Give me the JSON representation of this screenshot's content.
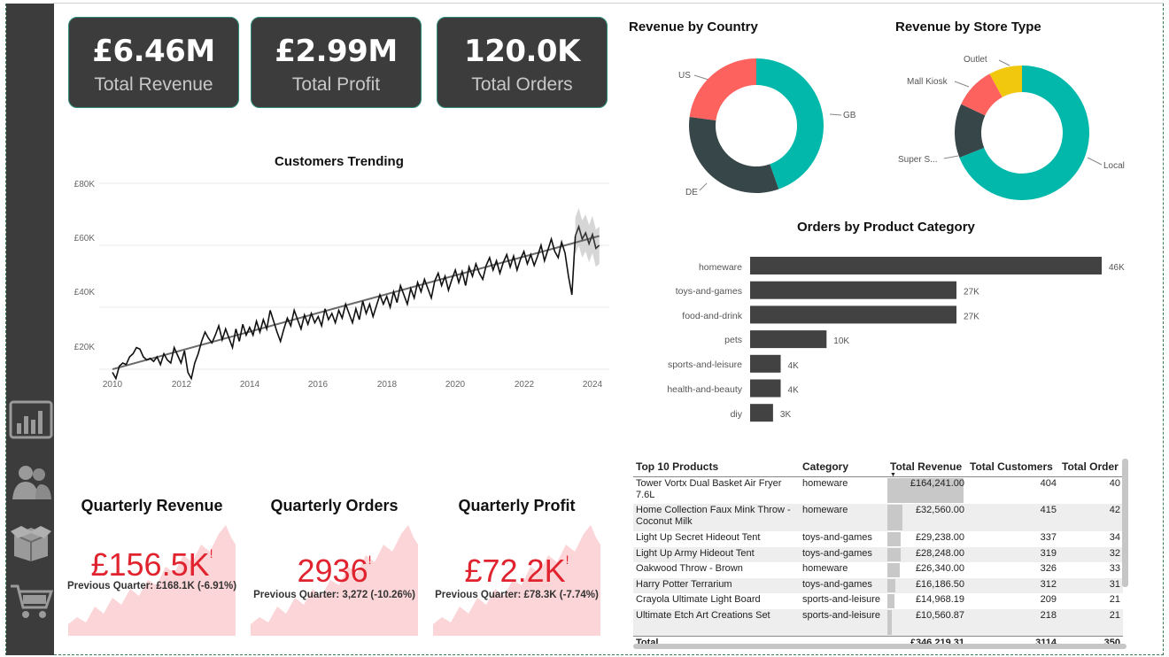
{
  "cards": [
    {
      "value": "£6.46M",
      "label": "Total Revenue"
    },
    {
      "value": "£2.99M",
      "label": "Total Profit"
    },
    {
      "value": "120.0K",
      "label": "Total Orders"
    }
  ],
  "nav": {
    "icons": [
      "bar-chart-icon",
      "users-icon",
      "package-icon",
      "cart-icon"
    ]
  },
  "customers_trending": {
    "title": "Customers Trending",
    "y_ticks": [
      "£80K",
      "£60K",
      "£40K",
      "£20K"
    ],
    "x_ticks": [
      "2010",
      "2012",
      "2014",
      "2016",
      "2018",
      "2020",
      "2022",
      "2024"
    ]
  },
  "revenue_by_country": {
    "title": "Revenue by Country",
    "labels": [
      "GB",
      "DE",
      "US"
    ]
  },
  "revenue_by_store": {
    "title": "Revenue by Store Type",
    "labels": [
      "Local",
      "Super S...",
      "Mall Kiosk",
      "Outlet"
    ]
  },
  "orders_by_category": {
    "title": "Orders by Product Category",
    "value_labels": [
      "46K",
      "27K",
      "27K",
      "10K",
      "4K",
      "4K",
      "3K"
    ]
  },
  "chart_data": [
    {
      "type": "line",
      "title": "Customers Trending",
      "xlabel": "",
      "ylabel": "",
      "xlim": [
        2010,
        2024.5
      ],
      "ylim": [
        10000,
        80000
      ],
      "series": [
        {
          "values": [
            [
              2010.0,
              19000
            ],
            [
              2010.1,
              17000
            ],
            [
              2010.2,
              21000
            ],
            [
              2010.3,
              22000
            ],
            [
              2010.4,
              21500
            ],
            [
              2010.5,
              24000
            ],
            [
              2010.6,
              25000
            ],
            [
              2010.7,
              27000
            ],
            [
              2010.8,
              26500
            ],
            [
              2010.9,
              24000
            ],
            [
              2011.0,
              23000
            ],
            [
              2011.1,
              23500
            ],
            [
              2011.2,
              22500
            ],
            [
              2011.3,
              24000
            ],
            [
              2011.4,
              21500
            ],
            [
              2011.5,
              25000
            ],
            [
              2011.6,
              23000
            ],
            [
              2011.7,
              22000
            ],
            [
              2011.8,
              27000
            ],
            [
              2011.9,
              24500
            ],
            [
              2012.0,
              22000
            ],
            [
              2012.1,
              26000
            ],
            [
              2012.2,
              19000
            ],
            [
              2012.3,
              17000
            ],
            [
              2012.4,
              22000
            ],
            [
              2012.5,
              25000
            ],
            [
              2012.6,
              29000
            ],
            [
              2012.7,
              32000
            ],
            [
              2012.8,
              30000
            ],
            [
              2012.9,
              28500
            ],
            [
              2013.0,
              31000
            ],
            [
              2013.1,
              34000
            ],
            [
              2013.2,
              29500
            ],
            [
              2013.3,
              33000
            ],
            [
              2013.4,
              30000
            ],
            [
              2013.5,
              27000
            ],
            [
              2013.6,
              33000
            ],
            [
              2013.7,
              29000
            ],
            [
              2013.8,
              34500
            ],
            [
              2013.9,
              31000
            ],
            [
              2014.0,
              33500
            ],
            [
              2014.1,
              31000
            ],
            [
              2014.2,
              35500
            ],
            [
              2014.3,
              32000
            ],
            [
              2014.4,
              36000
            ],
            [
              2014.5,
              33000
            ],
            [
              2014.6,
              39000
            ],
            [
              2014.7,
              35500
            ],
            [
              2014.8,
              32000
            ],
            [
              2014.9,
              29000
            ],
            [
              2015.0,
              33000
            ],
            [
              2015.1,
              36500
            ],
            [
              2015.2,
              34000
            ],
            [
              2015.3,
              39000
            ],
            [
              2015.4,
              36000
            ],
            [
              2015.5,
              33000
            ],
            [
              2015.6,
              37500
            ],
            [
              2015.7,
              34500
            ],
            [
              2015.8,
              38000
            ],
            [
              2015.9,
              35000
            ],
            [
              2016.0,
              37000
            ],
            [
              2016.1,
              34000
            ],
            [
              2016.2,
              39500
            ],
            [
              2016.3,
              36000
            ],
            [
              2016.4,
              38000
            ],
            [
              2016.5,
              35000
            ],
            [
              2016.6,
              39000
            ],
            [
              2016.7,
              36500
            ],
            [
              2016.8,
              41000
            ],
            [
              2016.9,
              38000
            ],
            [
              2017.0,
              35000
            ],
            [
              2017.1,
              39500
            ],
            [
              2017.2,
              36000
            ],
            [
              2017.3,
              42000
            ],
            [
              2017.4,
              38000
            ],
            [
              2017.5,
              41000
            ],
            [
              2017.6,
              37000
            ],
            [
              2017.7,
              40500
            ],
            [
              2017.8,
              44000
            ],
            [
              2017.9,
              41000
            ],
            [
              2018.0,
              43500
            ],
            [
              2018.1,
              40000
            ],
            [
              2018.2,
              45000
            ],
            [
              2018.3,
              41500
            ],
            [
              2018.4,
              47000
            ],
            [
              2018.5,
              44000
            ],
            [
              2018.6,
              41000
            ],
            [
              2018.7,
              46000
            ],
            [
              2018.8,
              43000
            ],
            [
              2018.9,
              48000
            ],
            [
              2019.0,
              45000
            ],
            [
              2019.1,
              49000
            ],
            [
              2019.2,
              46000
            ],
            [
              2019.3,
              43000
            ],
            [
              2019.4,
              48500
            ],
            [
              2019.5,
              51000
            ],
            [
              2019.6,
              47000
            ],
            [
              2019.7,
              50000
            ],
            [
              2019.8,
              45500
            ],
            [
              2019.9,
              49000
            ],
            [
              2020.0,
              52000
            ],
            [
              2020.1,
              48000
            ],
            [
              2020.2,
              51500
            ],
            [
              2020.3,
              47000
            ],
            [
              2020.4,
              53000
            ],
            [
              2020.5,
              50000
            ],
            [
              2020.6,
              54000
            ],
            [
              2020.7,
              51000
            ],
            [
              2020.8,
              49000
            ],
            [
              2020.9,
              53500
            ],
            [
              2021.0,
              56000
            ],
            [
              2021.1,
              52000
            ],
            [
              2021.2,
              55000
            ],
            [
              2021.3,
              51000
            ],
            [
              2021.4,
              54500
            ],
            [
              2021.5,
              57000
            ],
            [
              2021.6,
              53000
            ],
            [
              2021.7,
              56500
            ],
            [
              2021.8,
              52000
            ],
            [
              2021.9,
              55500
            ],
            [
              2022.0,
              58000
            ],
            [
              2022.1,
              54000
            ],
            [
              2022.2,
              57000
            ],
            [
              2022.3,
              53500
            ],
            [
              2022.4,
              56500
            ],
            [
              2022.5,
              60000
            ],
            [
              2022.6,
              55000
            ],
            [
              2022.7,
              58500
            ],
            [
              2022.8,
              62000
            ],
            [
              2022.9,
              58000
            ],
            [
              2023.0,
              56000
            ],
            [
              2023.1,
              61000
            ],
            [
              2023.2,
              57500
            ],
            [
              2023.3,
              50000
            ],
            [
              2023.4,
              44000
            ],
            [
              2023.5,
              63000
            ]
          ]
        },
        {
          "name": "forecast",
          "values": [
            [
              2023.5,
              63000
            ],
            [
              2023.6,
              66000
            ],
            [
              2023.7,
              62000
            ],
            [
              2023.8,
              64000
            ],
            [
              2023.9,
              60500
            ],
            [
              2024.0,
              63500
            ],
            [
              2024.1,
              59000
            ],
            [
              2024.2,
              60000
            ]
          ]
        },
        {
          "name": "trend",
          "values": [
            [
              2010.0,
              20000
            ],
            [
              2024.2,
              63000
            ]
          ]
        }
      ]
    },
    {
      "type": "pie",
      "title": "Revenue by Country",
      "labels": [
        "GB",
        "DE",
        "US"
      ],
      "values": [
        44.6,
        32.5,
        22.9
      ],
      "colors": [
        "#01b8aa",
        "#374649",
        "#fd625e"
      ]
    },
    {
      "type": "pie",
      "title": "Revenue by Store Type",
      "labels": [
        "Local",
        "Super S...",
        "Mall Kiosk",
        "Outlet"
      ],
      "values": [
        69,
        13,
        10,
        8
      ],
      "colors": [
        "#01b8aa",
        "#374649",
        "#fd625e",
        "#f2c80f"
      ]
    },
    {
      "type": "bar",
      "title": "Orders by Product Category",
      "categories": [
        "homeware",
        "toys-and-games",
        "food-and-drink",
        "pets",
        "sports-and-leisure",
        "health-and-beauty",
        "diy"
      ],
      "values": [
        46000,
        27000,
        27000,
        10000,
        4000,
        4000,
        3000
      ],
      "xlim": [
        0,
        46000
      ]
    }
  ],
  "quarterly": [
    {
      "title": "Quarterly Revenue",
      "value": "£156.5K",
      "prev": "Previous Quarter: £168.1K (-6.91%)"
    },
    {
      "title": "Quarterly Orders",
      "value": "2936",
      "prev": "Previous Quarter: 3,272 (-10.26%)"
    },
    {
      "title": "Quarterly Profit",
      "value": "£72.2K",
      "prev": "Previous Quarter: £78.3K (-7.74%)"
    }
  ],
  "top_products": {
    "headers": [
      "Top 10 Products",
      "Category",
      "Total Revenue",
      "Total Customers",
      "Total Order"
    ],
    "rows": [
      {
        "product": "Tower Vortx Dual Basket Air Fryer 7.6L",
        "category": "homeware",
        "revenue": "£164,241.00",
        "revenue_value": 164241,
        "customers": "404",
        "orders": "40"
      },
      {
        "product": "Home Collection Faux Mink Throw - Coconut Milk",
        "category": "homeware",
        "revenue": "£32,560.00",
        "revenue_value": 32560,
        "customers": "415",
        "orders": "42"
      },
      {
        "product": "Light Up Secret Hideout Tent",
        "category": "toys-and-games",
        "revenue": "£29,238.00",
        "revenue_value": 29238,
        "customers": "337",
        "orders": "34"
      },
      {
        "product": "Light Up Army Hideout Tent",
        "category": "toys-and-games",
        "revenue": "£28,248.00",
        "revenue_value": 28248,
        "customers": "319",
        "orders": "32"
      },
      {
        "product": "Oakwood Throw - Brown",
        "category": "homeware",
        "revenue": "£26,340.00",
        "revenue_value": 26340,
        "customers": "326",
        "orders": "33"
      },
      {
        "product": "Harry Potter Terrarium",
        "category": "toys-and-games",
        "revenue": "£16,186.50",
        "revenue_value": 16186.5,
        "customers": "312",
        "orders": "31"
      },
      {
        "product": "Crayola Ultimate Light Board",
        "category": "sports-and-leisure",
        "revenue": "£14,968.19",
        "revenue_value": 14968.19,
        "customers": "209",
        "orders": "21"
      },
      {
        "product": "Ultimate Etch Art Creations Set",
        "category": "sports-and-leisure",
        "revenue": "£10,560.87",
        "revenue_value": 10560.87,
        "customers": "218",
        "orders": "21"
      }
    ],
    "total": {
      "label": "Total",
      "revenue": "£346,219.31",
      "customers": "3114",
      "orders": "350"
    }
  }
}
